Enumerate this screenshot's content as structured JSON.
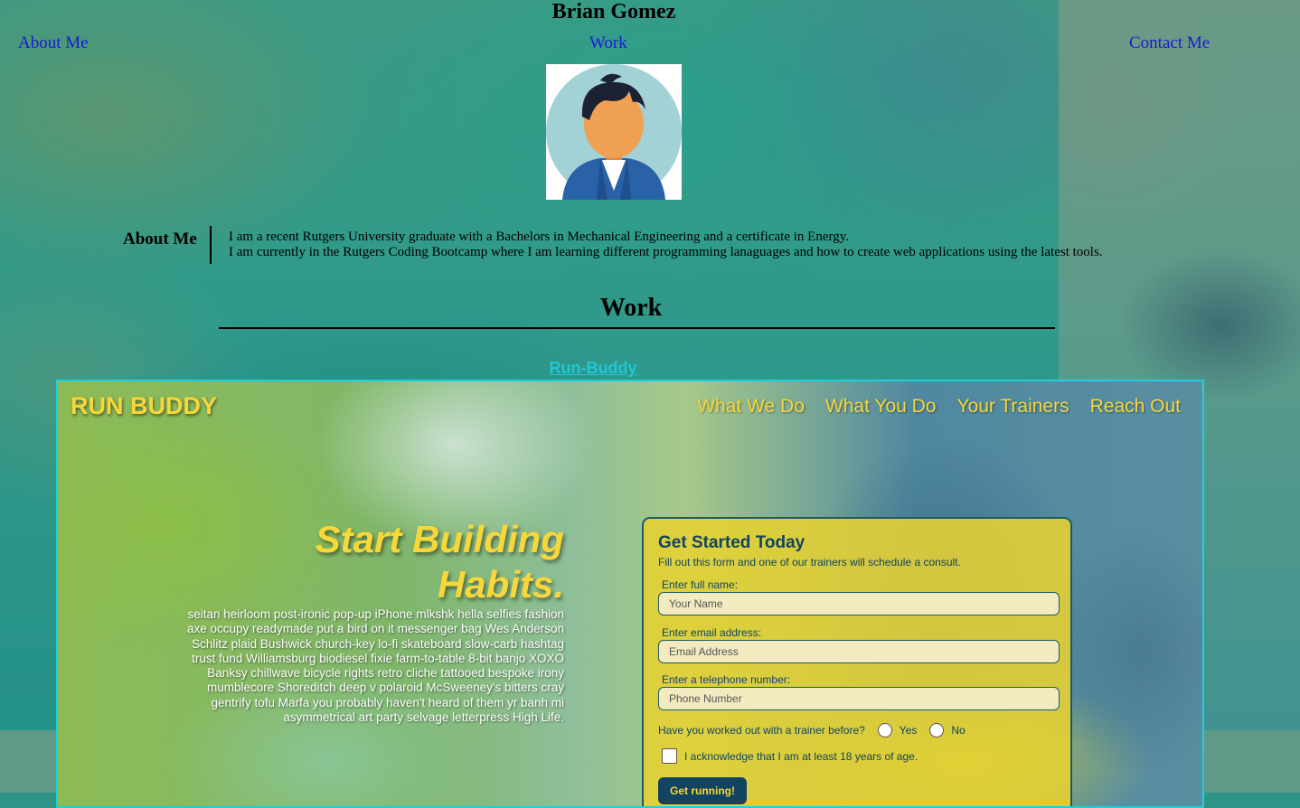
{
  "header": {
    "name": "Brian Gomez",
    "nav": {
      "about": "About Me",
      "work": "Work",
      "contact": "Contact Me"
    }
  },
  "about": {
    "heading": "About Me",
    "line1": "I am a recent Rutgers University graduate with a Bachelors in Mechanical Engineering and a certificate in Energy.",
    "line2": "I am currently in the Rutgers Coding Bootcamp where I am learning different programming lanaguages and how to create web applications using the latest tools."
  },
  "work": {
    "heading": "Work",
    "project_title": "Run-Buddy"
  },
  "preview": {
    "logo": "RUN BUDDY",
    "nav": [
      "What We Do",
      "What You Do",
      "Your Trainers",
      "Reach Out"
    ],
    "hero_title_1": "Start Building",
    "hero_title_2": "Habits.",
    "hero_text": "seitan heirloom post-ironic pop-up iPhone mlkshk hella selfies fashion axe occupy readymade put a bird on it messenger bag Wes Anderson Schlitz plaid Bushwick church-key lo-fi skateboard slow-carb hashtag trust fund Williamsburg biodiesel fixie farm-to-table 8-bit banjo XOXO Banksy chillwave bicycle rights retro cliche tattooed bespoke irony mumblecore Shoreditch deep v polaroid McSweeney's bitters cray gentrify tofu Marfa you probably haven't heard of them yr banh mi asymmetrical art party selvage letterpress High Life.",
    "form": {
      "title": "Get Started Today",
      "subtitle": "Fill out this form and one of our trainers will schedule a consult.",
      "name_label": "Enter full name:",
      "name_placeholder": "Your Name",
      "email_label": "Enter email address:",
      "email_placeholder": "Email Address",
      "phone_label": "Enter a telephone number:",
      "phone_placeholder": "Phone Number",
      "question": "Have you worked out with a trainer before?",
      "yes": "Yes",
      "no": "No",
      "ack": "I acknowledge that I am at least 18 years of age.",
      "submit": "Get running!"
    }
  },
  "colors": {
    "nav_link": "#1a1ad6",
    "project_link": "#21c6d8",
    "runbuddy_yellow": "#f7d73a",
    "runbuddy_navy": "#104460"
  }
}
